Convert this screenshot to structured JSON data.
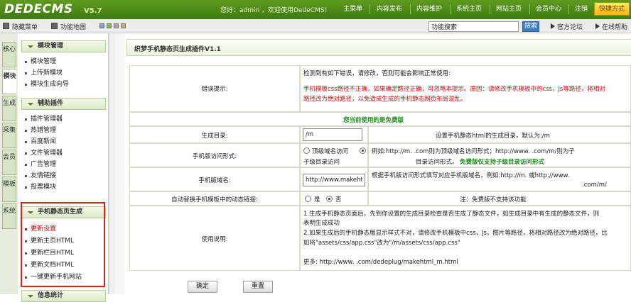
{
  "topbar": {
    "logo": "DEDECMS",
    "version": "V5.7",
    "welcome": "您好：admin ，欢迎使用DedeCMS！",
    "nav": [
      "主菜单",
      "内容发布",
      "内容维护",
      "系统主页",
      "网站主页",
      "会员中心",
      "注销"
    ],
    "quick": "快捷方式"
  },
  "toolbar": {
    "hide_menu": "隐藏菜单",
    "site_map": "功能地图",
    "search_placeholder": "功能搜索",
    "search_button": "搜索",
    "official_forum": "官方论坛",
    "online_help": "在线帮助"
  },
  "vtabs": [
    "核心",
    "模块",
    "生成",
    "采集",
    "会员",
    "模板",
    "系统"
  ],
  "sidebar": {
    "sections": [
      {
        "title": "模块管理",
        "items": [
          "模块管理",
          "上传新模块",
          "模块生成向导"
        ]
      },
      {
        "title": "辅助插件",
        "items": [
          "插件管理器",
          "热错管理",
          "百度新闻",
          "文件管理器",
          "广告管理",
          "友情链接",
          "投票模块"
        ]
      },
      {
        "title": "手机静态页生成",
        "items": [
          "更新设置",
          "更新主页HTML",
          "更新栏目HTML",
          "更新文档HTML",
          "一键更新手机网站"
        ]
      }
    ],
    "partial_next": "信息统计"
  },
  "main": {
    "title": "织梦手机静态页生成插件V1.1",
    "error": {
      "label": "错误提示:",
      "line1": "检测到有如下错误，请修改，否则可能会影响正常使用:",
      "line2": "手机模板css路径不正确，如果确定路径正确，可忽略本提示。原因：请修改手机模板中的css，js等路径，将相对",
      "line3": "路径改为绝对路径，以免造成生成的手机静态网页布局混乱。"
    },
    "free_notice": "您当前使用的是免费版",
    "gen_dir": {
      "label": "生成目录:",
      "value": "/m",
      "desc": "设置手机静态html的生成目录，默认为:/m"
    },
    "access": {
      "label": "手机版访问形式:",
      "opt1": "顶级域名访问",
      "opt2": "子级目录访问",
      "desc1": "例如:http://m.         .com则为顶级域名访问形式；http://www.          .com/m/则为子",
      "desc2a": "目录访问形式。",
      "desc2b": "免费版仅支持子级目录访问形式"
    },
    "domain": {
      "label": "手机版域名:",
      "value": "http://www.makeht",
      "desc1": "根据手机版访问形式填写对应手机版域名，例如:http://m.          或http://www.",
      "desc2": ".com/m/"
    },
    "auto": {
      "label": "自动替换手机模板中的动态链接:",
      "yes": "是",
      "no": "否",
      "desc": "注：免费版不支持该功能"
    },
    "usage": {
      "label": "使用说明:",
      "l1": "1.生成手机静态页面后，先到你设置的生成目录检查是否生成了静态文件，如生成目录中有生成的静态文件，则",
      "l2": "表明生成成功",
      "l3": "2.如果生成后的手机静态版显示样式不对，请修改手机模板中css，js，图片等路径，将相对路径改为绝对路径，比",
      "l4": "如将\"assets/css/app.css\"改为\"/m/assets/css/app.css\"",
      "l5": "更多: http://www.          .com/dedeplug/makehtml_m.html"
    },
    "buttons": {
      "ok": "确定",
      "reset": "重置"
    }
  },
  "colors": {
    "brand_green": "#4a8a18",
    "highlight_red": "#e02020",
    "warning_red": "#d01010",
    "notice_green": "#1a8a1a"
  }
}
